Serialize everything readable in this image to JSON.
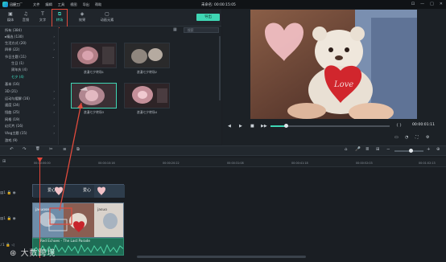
{
  "app": {
    "name": "迅捷工厂",
    "project_title": "未命名: 00:00:15:05"
  },
  "menu": [
    "文件",
    "编辑",
    "工具",
    "视图",
    "导出",
    "帮助"
  ],
  "window_controls": [
    "⊡",
    "—",
    "□",
    "✕"
  ],
  "tabs": [
    {
      "icon": "▣",
      "label": "媒体"
    },
    {
      "icon": "♫",
      "label": "音频"
    },
    {
      "icon": "T",
      "label": "文字"
    },
    {
      "icon": "⧉",
      "label": "转场"
    },
    {
      "icon": "◈",
      "label": "效果"
    },
    {
      "icon": "▢",
      "label": "动画元素"
    }
  ],
  "export_label": "导出",
  "search_placeholder": "搜索",
  "categories": [
    {
      "label": "所有 (384)",
      "chev": ""
    },
    {
      "label": "▸精选 (130)",
      "chev": "›"
    },
    {
      "label": "生活方式 (20)",
      "chev": "›"
    },
    {
      "label": "四季 (22)",
      "chev": "›"
    },
    {
      "label": "节日主题 (11)",
      "chev": "⌄"
    },
    {
      "label": "生日 (1)",
      "chev": ""
    },
    {
      "label": "周年庆 (4)",
      "chev": ""
    },
    {
      "label": "七夕 (4)",
      "chev": ""
    },
    {
      "label": "基本 (16)",
      "chev": ""
    },
    {
      "label": "3D (21)",
      "chev": "›"
    },
    {
      "label": "运动与缓解 (16)",
      "chev": "›"
    },
    {
      "label": "速度 (24)",
      "chev": "›"
    },
    {
      "label": "扭曲 (25)",
      "chev": "›"
    },
    {
      "label": "网格 (19)",
      "chev": ""
    },
    {
      "label": "幻灯片 (16)",
      "chev": "›"
    },
    {
      "label": "Vlog主题 (15)",
      "chev": "›"
    },
    {
      "label": "游戏 (9)",
      "chev": ""
    }
  ],
  "thumbnails": [
    {
      "label": "浪漫七夕转场1"
    },
    {
      "label": "浪漫七夕转场2"
    },
    {
      "label": "浪漫七夕转场3"
    },
    {
      "label": "浪漫七夕转场4"
    }
  ],
  "preview": {
    "timecode": "00:00:01:11",
    "video_text": "Love"
  },
  "playback_controls": [
    "◀",
    "▶",
    "■",
    "▶▶",
    "■"
  ],
  "toolbar_icons": [
    "↶",
    "↷",
    "🗑",
    "✂",
    "≡",
    "⧉"
  ],
  "ruler": [
    "00:00:00:00",
    "00:00:10:16",
    "00:00:20:22",
    "00:00:31:08",
    "00:00:41:18",
    "00:00:52:03",
    "00:01:02:13"
  ],
  "tracks": {
    "title_text": "爱心",
    "audio_label": "Red Echoes - The Last Parade"
  },
  "watermark": "大数跨境",
  "colors": {
    "accent": "#3fd6b4",
    "highlight": "#e04a3c"
  }
}
